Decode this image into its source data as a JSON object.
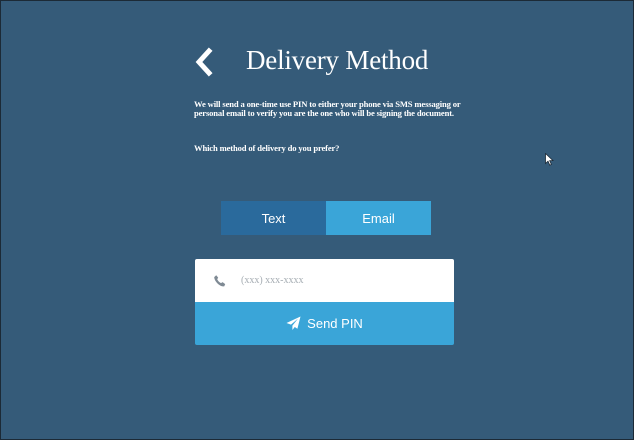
{
  "colors": {
    "background": "#355b79",
    "toggle_inactive": "#2a6a9c",
    "accent": "#3aa5d8",
    "text": "#ffffff",
    "placeholder": "#a6adb3"
  },
  "header": {
    "back_icon": "chevron-left-icon",
    "title": "Delivery Method"
  },
  "intro": {
    "text": "We will send a one-time use PIN to either your phone via SMS messaging or personal email to verify you are the one who will be signing the document.",
    "question": "Which method of delivery do you prefer?"
  },
  "delivery_toggle": {
    "options": [
      {
        "label": "Text",
        "selected": false
      },
      {
        "label": "Email",
        "selected": true
      }
    ]
  },
  "form": {
    "phone_icon": "phone-icon",
    "phone_placeholder": "(xxx) xxx-xxxx",
    "phone_value": "",
    "send_icon": "paper-plane-icon",
    "send_label": "Send PIN"
  },
  "cursor_icon": "mouse-pointer-icon"
}
